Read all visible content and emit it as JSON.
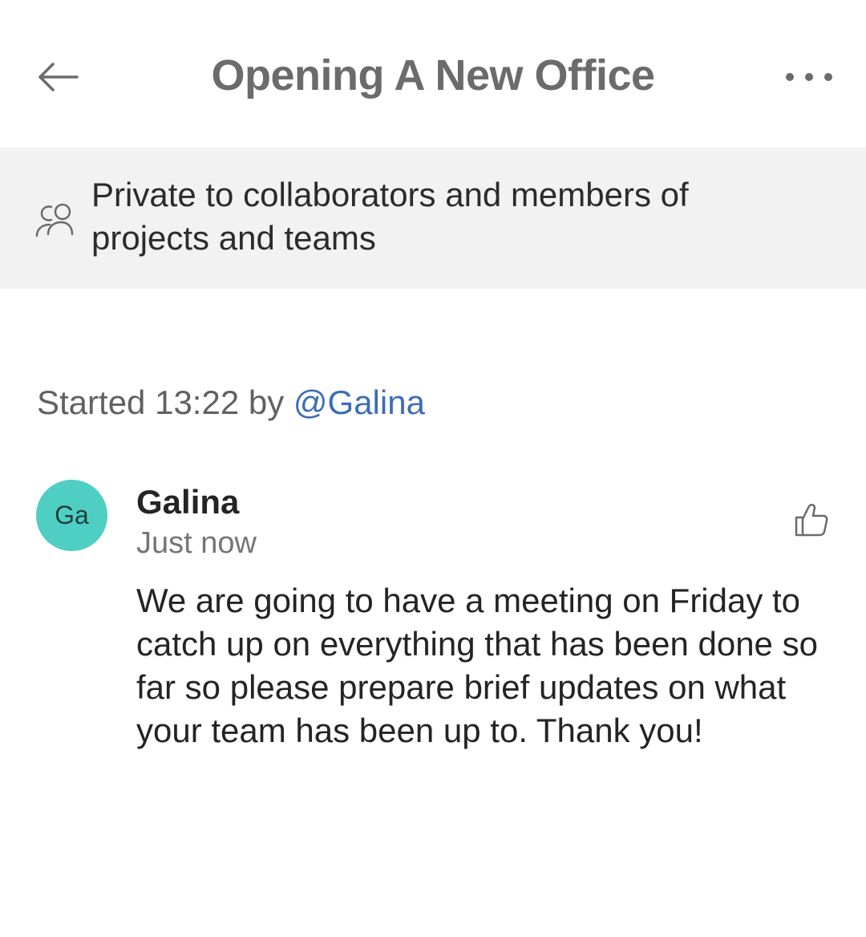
{
  "header": {
    "title": "Opening A New Office",
    "back_icon": "arrow-left-icon",
    "more_icon": "more-horizontal-icon"
  },
  "privacy": {
    "icon": "people-icon",
    "text": "Private to collaborators and members of projects and teams"
  },
  "thread": {
    "started_prefix": "Started 13:22 by ",
    "started_by": "@Galina"
  },
  "message": {
    "avatar_initials": "Ga",
    "avatar_color": "#4fcfc3",
    "author": "Galina",
    "timestamp": "Just now",
    "like_icon": "thumbs-up-icon",
    "body": "We are going to have a meeting on Friday to catch up on everything that has been done so far so please prepare brief updates on what your team has been up to. Thank you!"
  },
  "colors": {
    "banner_bg": "#f2f2f2",
    "mention": "#3d6db5"
  }
}
